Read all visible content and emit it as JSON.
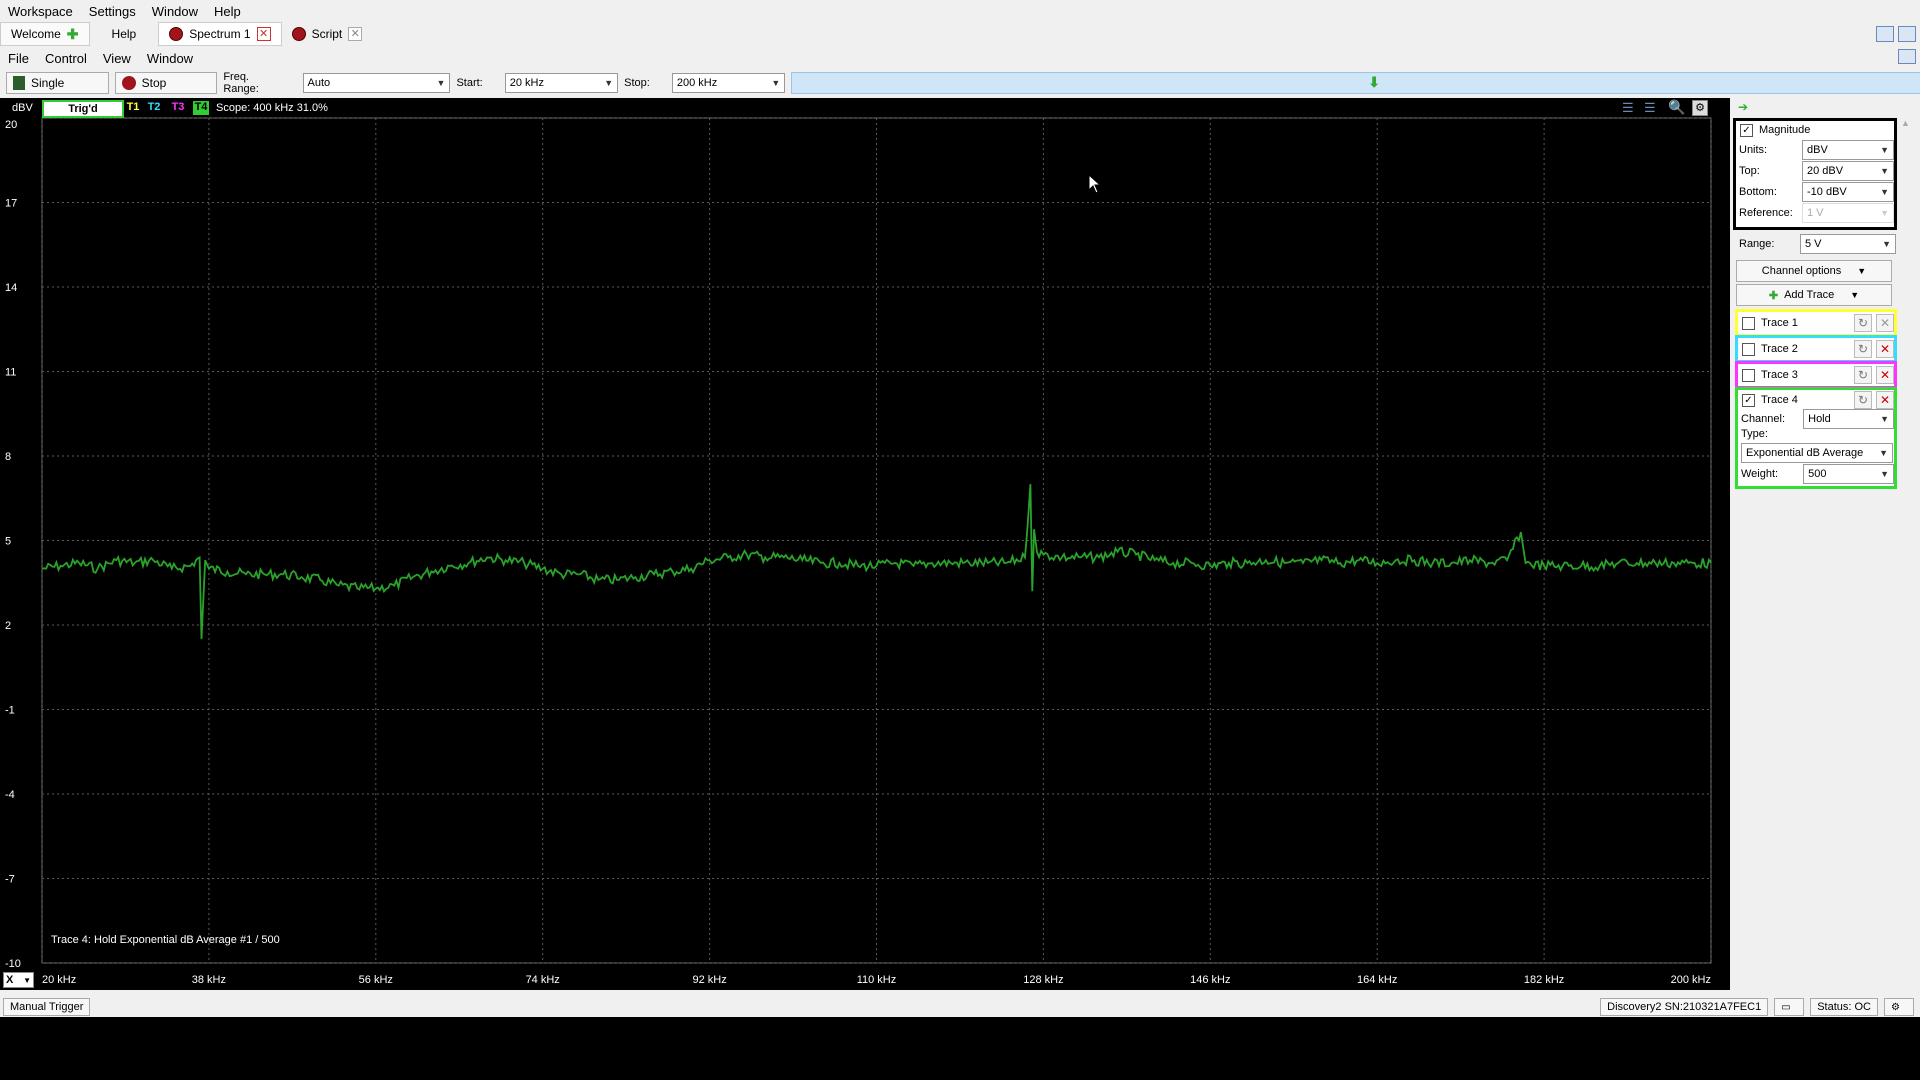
{
  "menu": [
    "Workspace",
    "Settings",
    "Window",
    "Help"
  ],
  "tabs": [
    {
      "label": "Welcome"
    },
    {
      "label": "Help"
    },
    {
      "label": "Spectrum 1"
    },
    {
      "label": "Script"
    }
  ],
  "submenu": [
    "File",
    "Control",
    "View",
    "Window"
  ],
  "toolbar": {
    "single": "Single",
    "stop": "Stop",
    "freq_range_label": "Freq. Range:",
    "freq_range": "Auto",
    "start_label": "Start:",
    "start": "20 kHz",
    "stop_label": "Stop:",
    "stop_value": "200 kHz"
  },
  "plot": {
    "unit": "dBV",
    "trig": "Trig'd",
    "t1": "T1",
    "t2": "T2",
    "t3": "T3",
    "t4": "T4",
    "scope": "Scope: 400 kHz 31.0%",
    "overlay": "Trace 4: Hold Exponential dB Average #1 / 500",
    "x_button": "X",
    "trace_color": "#2aa32a",
    "background": "#000000"
  },
  "chart_data": {
    "type": "line",
    "xlabel": "",
    "ylabel": "dBV",
    "xlim": [
      20,
      200
    ],
    "ylim": [
      -10,
      20
    ],
    "x_ticks": [
      "20 kHz",
      "38 kHz",
      "56 kHz",
      "74 kHz",
      "92 kHz",
      "110 kHz",
      "128 kHz",
      "146 kHz",
      "164 kHz",
      "182 kHz",
      "200 kHz"
    ],
    "y_ticks": [
      "20",
      "17",
      "14",
      "11",
      "8",
      "5",
      "2",
      "-1",
      "-4",
      "-7",
      "-10"
    ],
    "grid": true,
    "series": [
      {
        "x": [
          20,
          22,
          24,
          26,
          28,
          30,
          32,
          34,
          36,
          37,
          37.2,
          37.6,
          38,
          40,
          42,
          44,
          46,
          48,
          50,
          52,
          54,
          56,
          58,
          60,
          62,
          64,
          66,
          68,
          70,
          72,
          74,
          76,
          78,
          80,
          82,
          84,
          86,
          88,
          90,
          92,
          94,
          96,
          98,
          100,
          102,
          104,
          106,
          108,
          110,
          112,
          114,
          116,
          118,
          120,
          122,
          124,
          126,
          126.6,
          126.8,
          127,
          127.3,
          128,
          130,
          132,
          134,
          136,
          138,
          140,
          142,
          144,
          146,
          148,
          150,
          152,
          154,
          156,
          158,
          160,
          162,
          164,
          166,
          168,
          170,
          172,
          174,
          176,
          178,
          179.5,
          180,
          182,
          184,
          186,
          188,
          190,
          192,
          194,
          196,
          198,
          200
        ],
        "y": [
          4.0,
          4.1,
          4.2,
          4.0,
          4.3,
          4.2,
          4.3,
          4.0,
          4.1,
          4.4,
          1.5,
          4.3,
          4.0,
          3.9,
          3.8,
          3.8,
          3.8,
          3.7,
          3.6,
          3.4,
          3.3,
          3.3,
          3.4,
          3.7,
          3.9,
          4.1,
          4.2,
          4.4,
          4.3,
          4.2,
          4.0,
          3.8,
          3.8,
          3.6,
          3.6,
          3.7,
          3.8,
          3.9,
          4.0,
          4.3,
          4.4,
          4.5,
          4.4,
          4.4,
          4.3,
          4.2,
          4.2,
          4.1,
          4.1,
          4.2,
          4.1,
          4.2,
          4.2,
          4.2,
          4.2,
          4.2,
          4.4,
          7.0,
          3.2,
          5.4,
          4.6,
          4.5,
          4.4,
          4.4,
          4.4,
          4.6,
          4.5,
          4.3,
          4.2,
          4.2,
          4.1,
          4.2,
          4.2,
          4.3,
          4.2,
          4.2,
          4.3,
          4.2,
          4.3,
          4.2,
          4.3,
          4.3,
          4.2,
          4.2,
          4.3,
          4.2,
          4.3,
          5.3,
          4.2,
          4.1,
          4.1,
          4.1,
          4.1,
          4.2,
          4.2,
          4.2,
          4.2,
          4.2,
          4.2
        ]
      }
    ]
  },
  "sidebar": {
    "magnitude": "Magnitude",
    "units_label": "Units:",
    "units": "dBV",
    "top_label": "Top:",
    "top": "20 dBV",
    "bottom_label": "Bottom:",
    "bottom": "-10 dBV",
    "reference_label": "Reference:",
    "reference": "1 V",
    "range_label": "Range:",
    "range": "5 V",
    "channel_options": "Channel options",
    "add_trace": "Add Trace",
    "traces": [
      {
        "label": "Trace 1",
        "color": "#ffff33"
      },
      {
        "label": "Trace 2",
        "color": "#33ddff"
      },
      {
        "label": "Trace 3",
        "color": "#ff33ff"
      },
      {
        "label": "Trace 4",
        "color": "#33dd33"
      }
    ],
    "channel_label": "Channel:",
    "channel": "Hold",
    "type_label": "Type:",
    "type": "Exponential dB Average",
    "weight_label": "Weight:",
    "weight": "500"
  },
  "status": {
    "manual_trigger": "Manual Trigger",
    "device": "Discovery2 SN:210321A7FEC1",
    "status": "Status: OC"
  }
}
